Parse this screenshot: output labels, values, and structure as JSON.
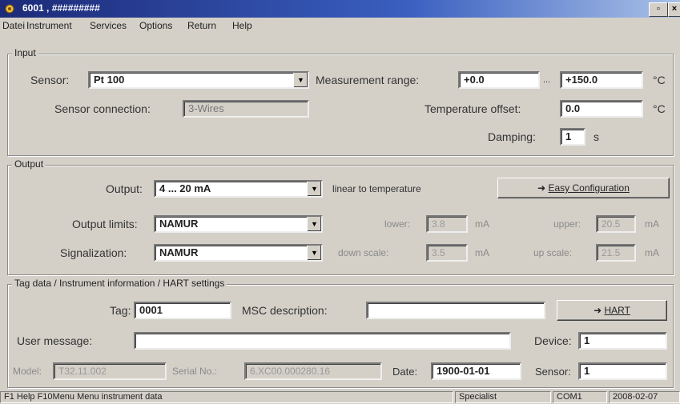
{
  "window": {
    "title": "6001  ,  #########"
  },
  "menu": [
    "Datei",
    "Instrument",
    "Services",
    "Options",
    "Return",
    "Help"
  ],
  "input": {
    "group_label": "Input",
    "sensor_label": "Sensor:",
    "sensor_value": "Pt 100",
    "measurement_range_label": "Measurement range:",
    "range_low": "+0.0",
    "range_sep": "...",
    "range_high": "+150.0",
    "range_unit": "°C",
    "sensor_connection_label": "Sensor connection:",
    "sensor_connection_value": "3-Wires",
    "temperature_offset_label": "Temperature offset:",
    "temperature_offset_value": "0.0",
    "temperature_offset_unit": "°C",
    "damping_label": "Damping:",
    "damping_value": "1",
    "damping_unit": "s"
  },
  "output": {
    "group_label": "Output",
    "output_label": "Output:",
    "output_value": "4 ... 20 mA",
    "linear_label": "linear to temperature",
    "easy_config_label": "Easy Configuration",
    "output_limits_label": "Output limits:",
    "output_limits_value": "NAMUR",
    "lower_label": "lower:",
    "lower_value": "3.8",
    "lower_unit": "mA",
    "upper_label": "upper:",
    "upper_value": "20.5",
    "upper_unit": "mA",
    "signalization_label": "Signalization:",
    "signalization_value": "NAMUR",
    "down_scale_label": "down scale:",
    "down_scale_value": "3.5",
    "down_scale_unit": "mA",
    "up_scale_label": "up scale:",
    "up_scale_value": "21.5",
    "up_scale_unit": "mA"
  },
  "tag": {
    "group_label": "Tag data / Instrument information / HART settings",
    "tag_label": "Tag:",
    "tag_value": "0001",
    "msc_label": "MSC description:",
    "msc_value": "",
    "hart_button_label": "HART",
    "user_message_label": "User message:",
    "user_message_value": "",
    "device_label": "Device:",
    "device_value": "1",
    "model_label": "Model:",
    "model_value": "T32.11.002",
    "serial_label": "Serial No.:",
    "serial_value": "6.XC00.000280.16",
    "date_label": "Date:",
    "date_value": "1900-01-01",
    "sensor_label": "Sensor:",
    "sensor_value": "1"
  },
  "statusbar": {
    "help": "F1 Help  F10Menu  Menu instrument data",
    "user": "Specialist",
    "port": "COM1",
    "date": "2008-02-07"
  }
}
